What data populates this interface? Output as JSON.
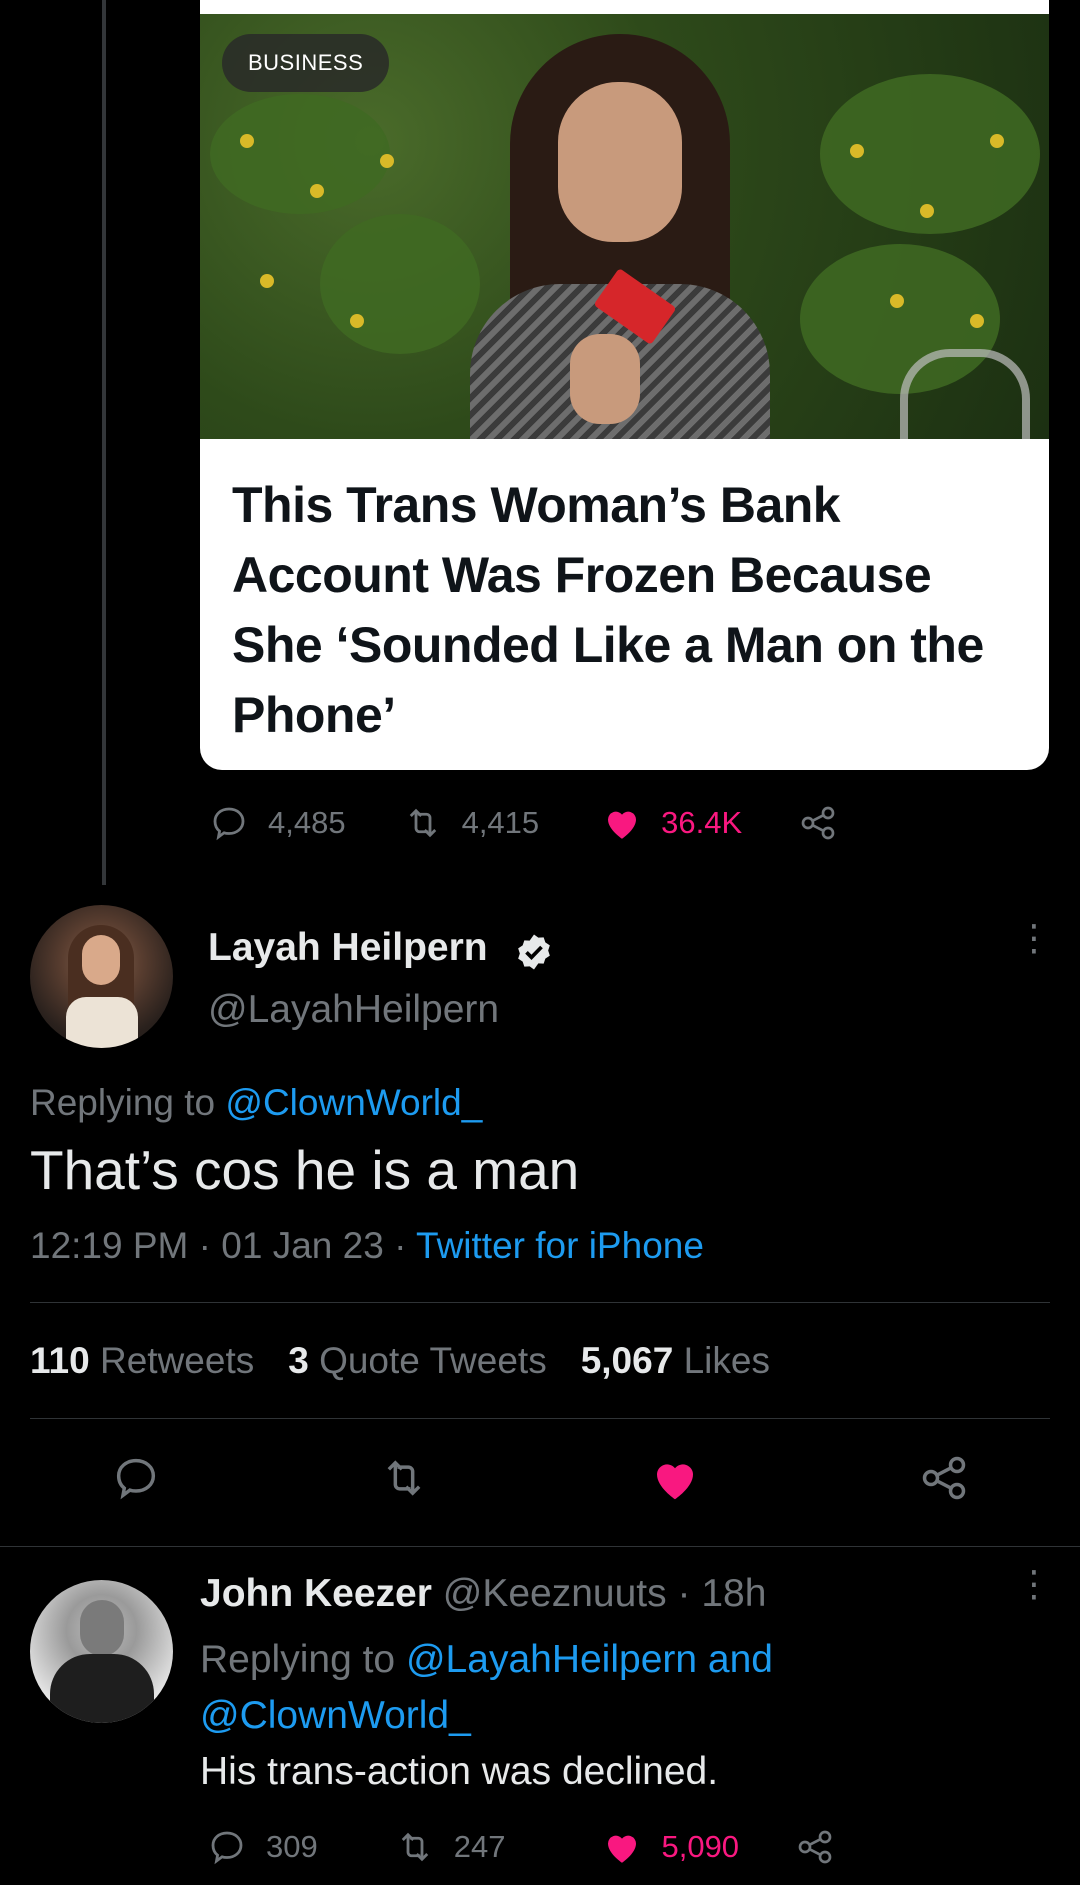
{
  "quoted_card": {
    "badge": "BUSINESS",
    "headline": "This Trans Woman’s Bank Account Was Frozen Because She ‘Sounded Like a Man on the Phone’"
  },
  "original_tweet_actions": {
    "replies": "4,485",
    "retweets": "4,415",
    "likes": "36.4K"
  },
  "main_tweet": {
    "display_name": "Layah Heilpern",
    "handle": "@LayahHeilpern",
    "replying_prefix": "Replying to",
    "replying_to": "@ClownWorld_",
    "text": "That’s cos he is a man",
    "time": "12:19 PM",
    "date": "01 Jan 23",
    "source": "Twitter for iPhone",
    "stats": {
      "retweets_count": "110",
      "retweets_label": "Retweets",
      "quotes_count": "3",
      "quotes_label": "Quote Tweets",
      "likes_count": "5,067",
      "likes_label": "Likes"
    }
  },
  "reply_tweet": {
    "display_name": "John Keezer",
    "handle": "@Keeznuuts",
    "age": "18h",
    "replying_prefix": "Replying to",
    "replying_to_1": "@LayahHeilpern",
    "replying_and": "and",
    "replying_to_2": "@ClownWorld_",
    "text": "His trans-action was declined.",
    "replies": "309",
    "retweets": "247",
    "likes": "5,090"
  },
  "colors": {
    "background": "#000000",
    "text_primary": "#e7e9ea",
    "text_secondary": "#71767b",
    "accent_blue": "#1d9bf0",
    "like_pink": "#f91880"
  },
  "icons": [
    "reply-icon",
    "retweet-icon",
    "heart-icon",
    "share-icon",
    "verified-badge-icon",
    "more-icon"
  ]
}
